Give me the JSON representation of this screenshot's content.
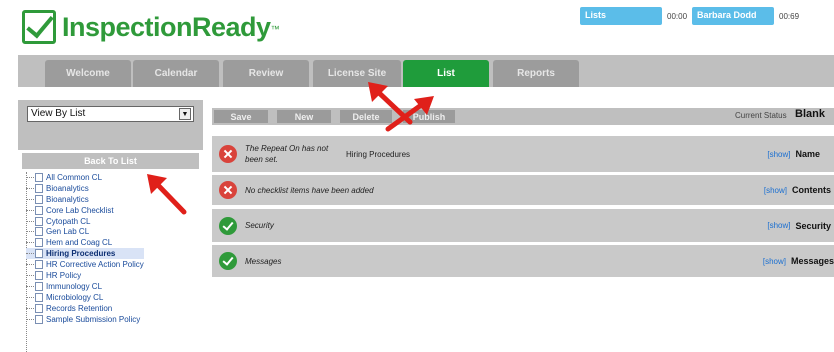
{
  "app": {
    "logo_text": "InspectionReady",
    "tm": "™"
  },
  "topbar": {
    "lists": "Lists",
    "time1": "00:00",
    "user": "Barbara Dodd",
    "time2": "00:69"
  },
  "nav": {
    "tabs": [
      "Welcome",
      "Calendar",
      "Review",
      "License Site",
      "List",
      "Reports"
    ],
    "active": "List"
  },
  "left": {
    "view_select": "View By List",
    "back_button": "Back To List",
    "items": [
      "All Common CL",
      "Bioanalytics",
      "Bioanalytics",
      "Core Lab Checklist",
      "Cytopath CL",
      "Gen Lab CL",
      "Hem and Coag CL",
      "Hiring Procedures",
      "HR Corrective Action Policy",
      "HR Policy",
      "Immunology CL",
      "Microbiology CL",
      "Records Retention",
      "Sample Submission Policy"
    ],
    "selected": "Hiring Procedures"
  },
  "actions": {
    "save": "Save",
    "new": "New",
    "delete": "Delete",
    "publish": "Publish"
  },
  "current_status": {
    "label": "Current Status",
    "value": "Blank"
  },
  "rows": [
    {
      "status": "error",
      "message": "The Repeat On has not been set.",
      "extra": "Hiring Procedures",
      "show": "[show]",
      "name": "Name"
    },
    {
      "status": "error",
      "message": "No checklist items have been added",
      "extra": "",
      "show": "[show]",
      "name": "Contents"
    },
    {
      "status": "ok",
      "message": "Security",
      "extra": "",
      "show": "[show]",
      "name": "Security"
    },
    {
      "status": "ok",
      "message": "Messages",
      "extra": "",
      "show": "[show]",
      "name": "Messages"
    }
  ],
  "colors": {
    "brand_green": "#2f9a3a",
    "active_tab": "#1f9c3b",
    "top_pill": "#5bbde9",
    "error": "#d9433b",
    "link": "#1a6fd1"
  },
  "icons": [
    "check-logo-icon",
    "dropdown-arrow-icon",
    "document-icon",
    "error-x-icon",
    "success-check-icon",
    "red-arrow-pointer"
  ]
}
